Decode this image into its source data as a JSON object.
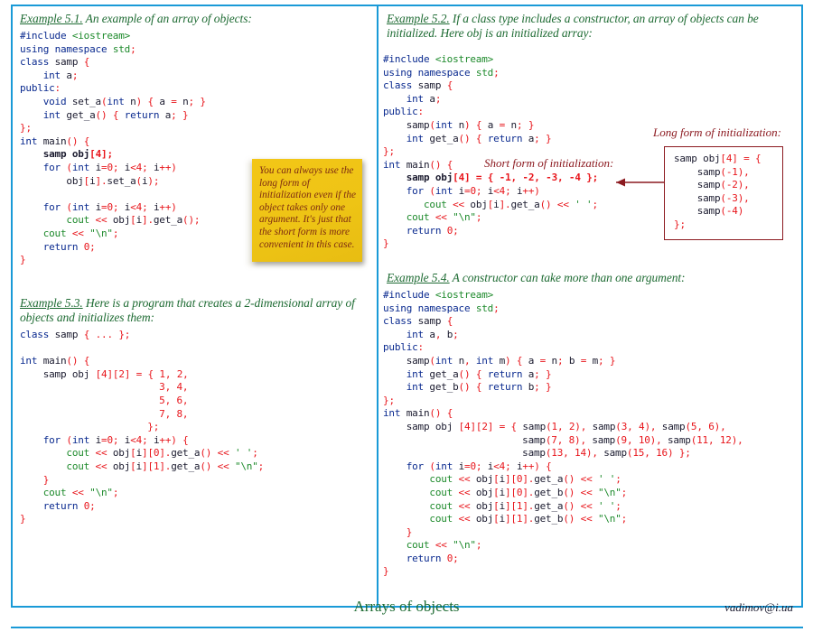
{
  "theme": {
    "frame_color": "#1a9ad7",
    "heading_color": "#1e6b33",
    "keyword_color": "#0a2a8f",
    "punct_color": "#e8151b",
    "string_color": "#1d8a2b",
    "callout_color": "#8c1a20",
    "note_bg": "#eec415",
    "note_text": "#7d2b12"
  },
  "examples": {
    "ex51": {
      "label": "Example 5.1.",
      "caption": " An example of an array of objects:",
      "code_lines": [
        "#include <iostream>",
        "using namespace std;",
        "class samp {",
        "    int a;",
        "public:",
        "    void set_a(int n) { a = n; }",
        "    int get_a() { return a; }",
        "};",
        "int main() {",
        "    samp obj[4];",
        "    for (int i=0; i<4; i++)",
        "        obj[i].set_a(i);",
        "",
        "    for (int i=0; i<4; i++)",
        "        cout << obj[i].get_a();",
        "    cout << \"\\n\";",
        "    return 0;",
        "}"
      ]
    },
    "ex52": {
      "label": "Example 5.2.",
      "caption": " If a class type includes a constructor, an array of objects can be initialized. Here obj is an initialized array:",
      "code_lines": [
        "#include <iostream>",
        "using namespace std;",
        "class samp {",
        "    int a;",
        "public:",
        "    samp(int n) { a = n; }",
        "    int get_a() { return a; }",
        "};",
        "int main() {",
        "    samp obj[4] = { -1, -2, -3, -4 };",
        "    for (int i=0; i<4; i++)",
        "       cout << obj[i].get_a() << ' ';",
        "    cout << \"\\n\";",
        "    return 0;",
        "}"
      ],
      "short_form_label": "Short form of initialization:",
      "long_form_label": "Long form of initialization:",
      "long_form_code": [
        "samp obj[4] = {",
        "    samp(-1),",
        "    samp(-2),",
        "    samp(-3),",
        "    samp(-4)",
        "};"
      ]
    },
    "ex53": {
      "label": "Example 5.3.",
      "caption": " Here is a program that creates a 2-dimensional array of objects and initializes them:",
      "code_lines": [
        "class samp { ... };",
        "",
        "int main() {",
        "    samp obj [4][2] = { 1, 2,",
        "                        3, 4,",
        "                        5, 6,",
        "                        7, 8,",
        "                      };",
        "    for (int i=0; i<4; i++) {",
        "        cout << obj[i][0].get_a() << ' ';",
        "        cout << obj[i][1].get_a() << \"\\n\";",
        "    }",
        "    cout << \"\\n\";",
        "    return 0;",
        "}"
      ]
    },
    "ex54": {
      "label": "Example 5.4.",
      "caption": " A constructor can take more than one argument:",
      "code_lines": [
        "#include <iostream>",
        "using namespace std;",
        "class samp {",
        "    int a, b;",
        "public:",
        "    samp(int n, int m) { a = n; b = m; }",
        "    int get_a() { return a; }",
        "    int get_b() { return b; }",
        "};",
        "int main() {",
        "    samp obj [4][2] = { samp(1, 2), samp(3, 4), samp(5, 6),",
        "                        samp(7, 8), samp(9, 10), samp(11, 12),",
        "                        samp(13, 14), samp(15, 16) };",
        "    for (int i=0; i<4; i++) {",
        "        cout << obj[i][0].get_a() << ' ';",
        "        cout << obj[i][0].get_b() << \"\\n\";",
        "        cout << obj[i][1].get_a() << ' ';",
        "        cout << obj[i][1].get_b() << \"\\n\";",
        "    }",
        "    cout << \"\\n\";",
        "    return 0;",
        "}"
      ]
    }
  },
  "sticky_note": {
    "text": "You can always use the long form of initialization even if the object takes only one argument. It's just that the short form is more convenient in this case."
  },
  "footer": {
    "title": "Arrays of objects",
    "email": "vadimov@i.ua"
  }
}
